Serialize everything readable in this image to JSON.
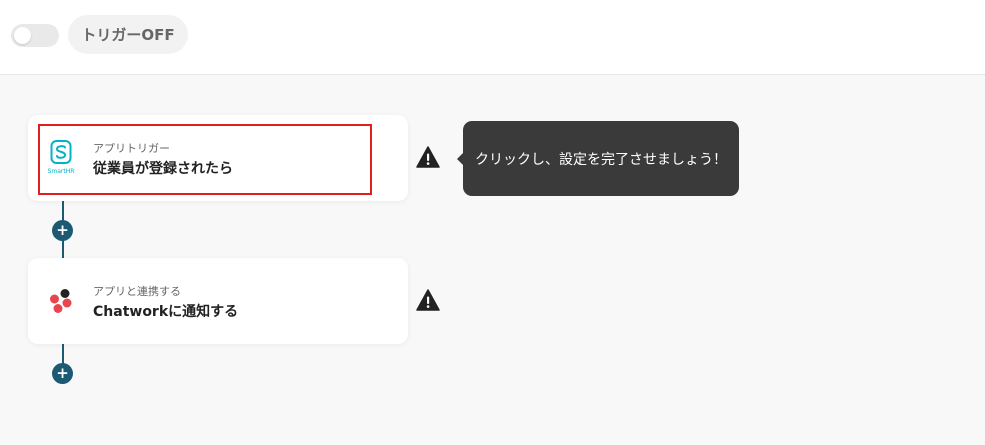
{
  "header": {
    "toggle_state": "off",
    "trigger_label": "トリガーOFF"
  },
  "flow": {
    "steps": [
      {
        "category": "アプリトリガー",
        "title": "従業員が登録されたら",
        "app": "SmartHR",
        "icon": "smarthr-logo-icon",
        "brand_color": "#00b3c7",
        "status_icon": "warning-icon"
      },
      {
        "category": "アプリと連携する",
        "title": "Chatworkに通知する",
        "icon": "chatwork-logo-icon",
        "brand_color": "#e8454f",
        "status_icon": "warning-icon"
      }
    ],
    "add_button_label": "+"
  },
  "tooltip": {
    "text": "クリックし、設定を完了させましょう！"
  },
  "colors": {
    "connector": "#1c5a73",
    "highlight": "#e02020",
    "tooltip_bg": "#3a3a3a"
  }
}
